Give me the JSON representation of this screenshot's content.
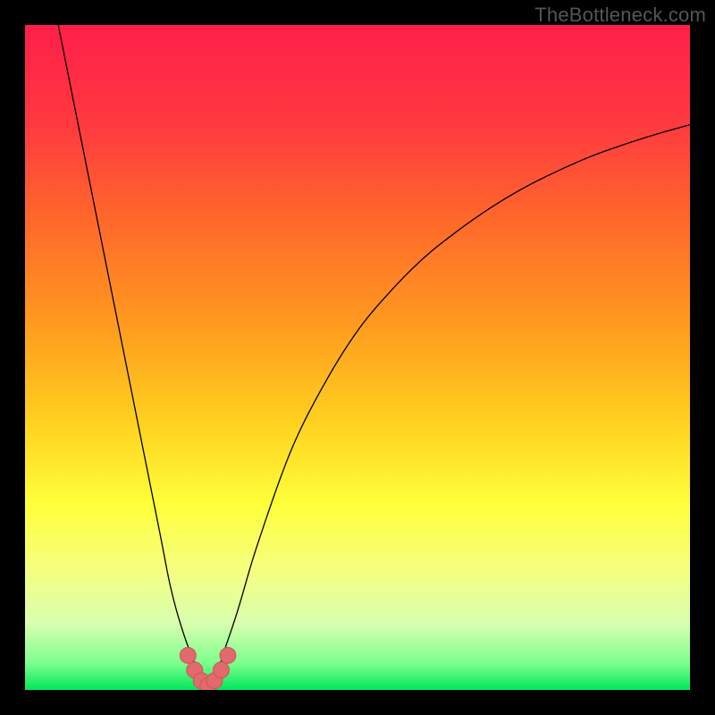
{
  "attribution": "TheBottleneck.com",
  "colors": {
    "frame": "#000000",
    "curve_stroke": "#000000",
    "marker_fill": "#e06a6c",
    "marker_stroke": "#d35557",
    "gradient_stops": [
      {
        "offset": 0.0,
        "color": "#ff1f4a"
      },
      {
        "offset": 0.15,
        "color": "#ff3a3f"
      },
      {
        "offset": 0.3,
        "color": "#ff6a2a"
      },
      {
        "offset": 0.45,
        "color": "#ff9a1f"
      },
      {
        "offset": 0.6,
        "color": "#ffd21f"
      },
      {
        "offset": 0.72,
        "color": "#ffff3a"
      },
      {
        "offset": 0.82,
        "color": "#f5ff80"
      },
      {
        "offset": 0.9,
        "color": "#d8ffb0"
      },
      {
        "offset": 0.96,
        "color": "#7cff8c"
      },
      {
        "offset": 1.0,
        "color": "#00e85a"
      }
    ]
  },
  "chart_data": {
    "type": "line",
    "title": "",
    "xlabel": "",
    "ylabel": "",
    "xlim": [
      0,
      100
    ],
    "ylim": [
      0,
      100
    ],
    "series": [
      {
        "name": "bottleneck-curve",
        "x": [
          5,
          10,
          15,
          20,
          22,
          24,
          26,
          27.5,
          29,
          30,
          32,
          35,
          40,
          45,
          50,
          55,
          60,
          65,
          70,
          75,
          80,
          85,
          90,
          95,
          100
        ],
        "values": [
          100,
          75,
          50,
          25,
          15,
          8,
          3,
          0,
          3,
          6,
          12,
          22,
          36,
          46,
          54,
          60,
          65,
          69,
          72.5,
          75.5,
          78,
          80.2,
          82,
          83.6,
          85
        ]
      }
    ],
    "markers": {
      "name": "optimum-region",
      "x": [
        24.5,
        25.5,
        26.5,
        27.5,
        28.5,
        29.5,
        30.5
      ],
      "values": [
        5.2,
        3.0,
        1.4,
        0.6,
        1.4,
        3.0,
        5.2
      ]
    }
  }
}
